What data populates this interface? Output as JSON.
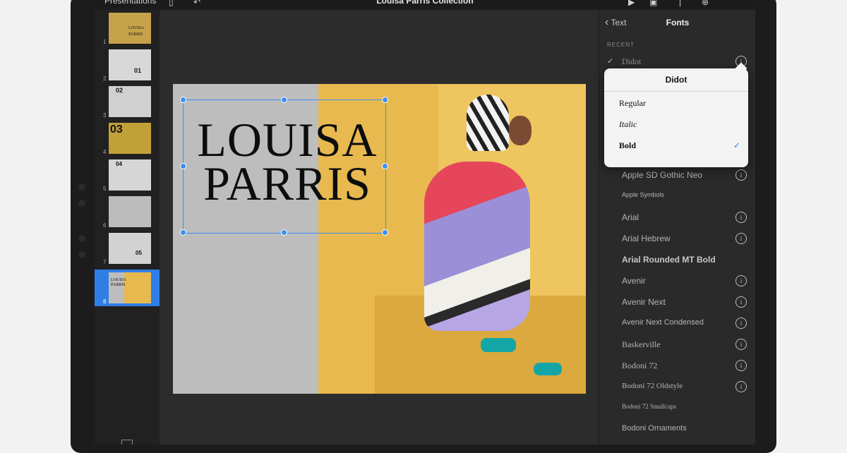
{
  "app": {
    "breadcrumb": "Presentations",
    "document_title": "Louisa Parris Collection"
  },
  "slides": [
    {
      "number": "1",
      "preview_text": "LOUISA PARRIS"
    },
    {
      "number": "2",
      "preview_text": "01"
    },
    {
      "number": "3",
      "preview_text": "02"
    },
    {
      "number": "4",
      "preview_text": "03"
    },
    {
      "number": "5",
      "preview_text": "04"
    },
    {
      "number": "6",
      "preview_text": ""
    },
    {
      "number": "7",
      "preview_text": "05"
    },
    {
      "number": "8",
      "preview_text": "LOUISA PARRIS"
    }
  ],
  "selected_slide": "8",
  "slide": {
    "title_line1": "LOUISA",
    "title_line2": "PARRIS"
  },
  "panel": {
    "back_label": "Text",
    "title": "Fonts",
    "section_recent": "RECENT",
    "recent_font": "Didot"
  },
  "popover": {
    "title": "Didot",
    "styles": [
      "Regular",
      "Italic",
      "Bold"
    ],
    "selected_style": "Bold"
  },
  "fonts": [
    "Apple SD Gothic Neo",
    "Apple Symbols",
    "Arial",
    "Arial Hebrew",
    "Arial Rounded MT Bold",
    "Avenir",
    "Avenir Next",
    "Avenir Next Condensed",
    "Baskerville",
    "Bodoni 72",
    "Bodoni 72 Oldstyle",
    "Bodoni 72 Smallcaps",
    "Bodoni Ornaments"
  ],
  "colors": {
    "accent": "#2f7ee6",
    "photo_background": "#e7b94f",
    "slide_gray": "#bdbdbd"
  },
  "icons": {
    "back": "chevron-left-icon",
    "info": "info-icon",
    "check": "checkmark-icon"
  }
}
